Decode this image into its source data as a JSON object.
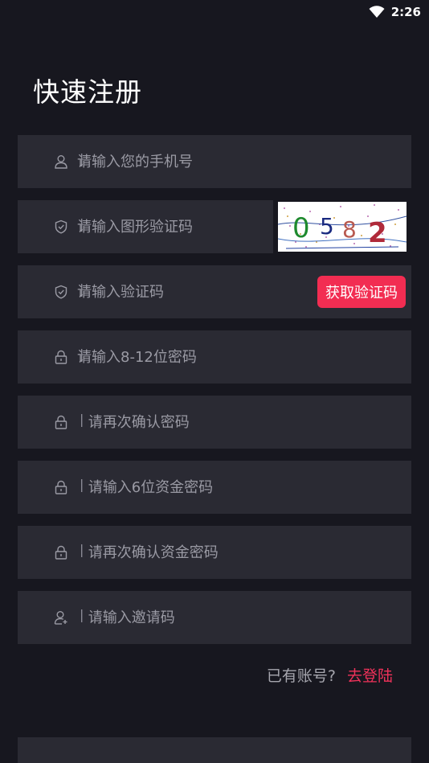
{
  "status_bar": {
    "time": "2:26",
    "wifi_icon": "wifi-icon"
  },
  "page_title": "快速注册",
  "form": {
    "separator": "|",
    "phone": {
      "placeholder": "请输入您的手机号",
      "icon": "user-icon"
    },
    "image_captcha": {
      "placeholder": "请输入图形验证码",
      "icon": "shield-check-icon"
    },
    "sms_code": {
      "placeholder": "请输入验证码",
      "icon": "shield-check-icon",
      "button_label": "获取验证码"
    },
    "password": {
      "placeholder": "请输入8-12位密码",
      "icon": "lock-icon"
    },
    "password_confirm": {
      "placeholder": " 请再次确认密码",
      "icon": "lock-icon"
    },
    "fund_password": {
      "placeholder": " 请输入6位资金密码",
      "icon": "lock-icon"
    },
    "fund_password_confirm": {
      "placeholder": " 请再次确认资金密码",
      "icon": "lock-icon"
    },
    "invite_code": {
      "placeholder": " 请输入邀请码",
      "icon": "user-add-icon"
    }
  },
  "login": {
    "hint": "已有账号?",
    "link": "去登陆"
  },
  "colors": {
    "background": "#17171f",
    "field": "#2a2a33",
    "accent": "#f22d52"
  }
}
